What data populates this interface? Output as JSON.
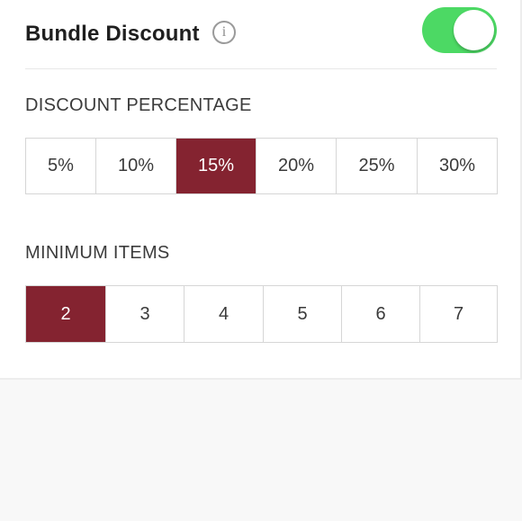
{
  "header": {
    "title": "Bundle Discount",
    "info_glyph": "i",
    "toggle_on": true
  },
  "discount": {
    "label": "DISCOUNT PERCENTAGE",
    "options": [
      "5%",
      "10%",
      "15%",
      "20%",
      "25%",
      "30%"
    ],
    "selected": "15%"
  },
  "minimum": {
    "label": "MINIMUM ITEMS",
    "options": [
      "2",
      "3",
      "4",
      "5",
      "6",
      "7"
    ],
    "selected": "2"
  },
  "colors": {
    "accent": "#842330",
    "toggle_on": "#4cd964"
  },
  "icons": {
    "info": "info-icon"
  }
}
